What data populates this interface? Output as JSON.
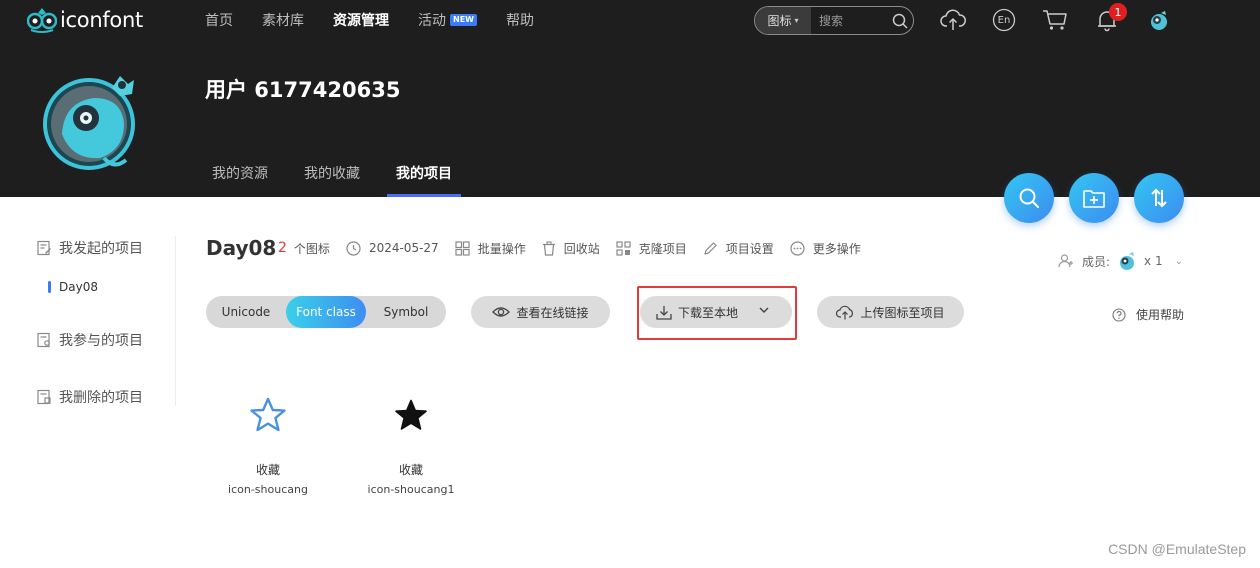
{
  "header": {
    "logo_text": "iconfont",
    "nav": [
      {
        "label": "首页"
      },
      {
        "label": "素材库"
      },
      {
        "label": "资源管理",
        "active": true
      },
      {
        "label": "活动",
        "badge": "NEW"
      },
      {
        "label": "帮助"
      }
    ],
    "search": {
      "type_label": "图标",
      "placeholder": "搜索"
    },
    "lang_label": "En",
    "notification_count": "1"
  },
  "profile": {
    "username": "用户 6177420635",
    "tabs": [
      {
        "label": "我的资源"
      },
      {
        "label": "我的收藏"
      },
      {
        "label": "我的项目",
        "active": true
      }
    ]
  },
  "sidebar": {
    "items": [
      {
        "label": "我发起的项目"
      },
      {
        "label": "我参与的项目"
      },
      {
        "label": "我删除的项目"
      }
    ],
    "sub_item": "Day08"
  },
  "project": {
    "name": "Day08",
    "icon_count": "2",
    "icon_count_unit": "个图标",
    "date": "2024-05-27",
    "actions": [
      {
        "label": "批量操作",
        "icon": "grid-icon"
      },
      {
        "label": "回收站",
        "icon": "trash-icon"
      },
      {
        "label": "克隆项目",
        "icon": "clone-icon"
      },
      {
        "label": "项目设置",
        "icon": "pencil-icon"
      },
      {
        "label": "更多操作",
        "icon": "more-icon"
      }
    ],
    "members_label": "成员:",
    "members_count": "x 1"
  },
  "toolbar": {
    "formats": [
      "Unicode",
      "Font class",
      "Symbol"
    ],
    "active_format": "Font class",
    "view_link": "查看在线链接",
    "download": "下载至本地",
    "upload": "上传图标至项目",
    "help": "使用帮助"
  },
  "icons": [
    {
      "name": "收藏",
      "code": "icon-shoucang",
      "style": "outline",
      "color": "#4a90e2"
    },
    {
      "name": "收藏",
      "code": "icon-shoucang1",
      "style": "filled",
      "color": "#111111"
    }
  ],
  "watermark": "CSDN @EmulateStep",
  "colors": {
    "accent": "#3d8ef0",
    "highlight": "#e23b3b",
    "count_red": "#e53935"
  }
}
